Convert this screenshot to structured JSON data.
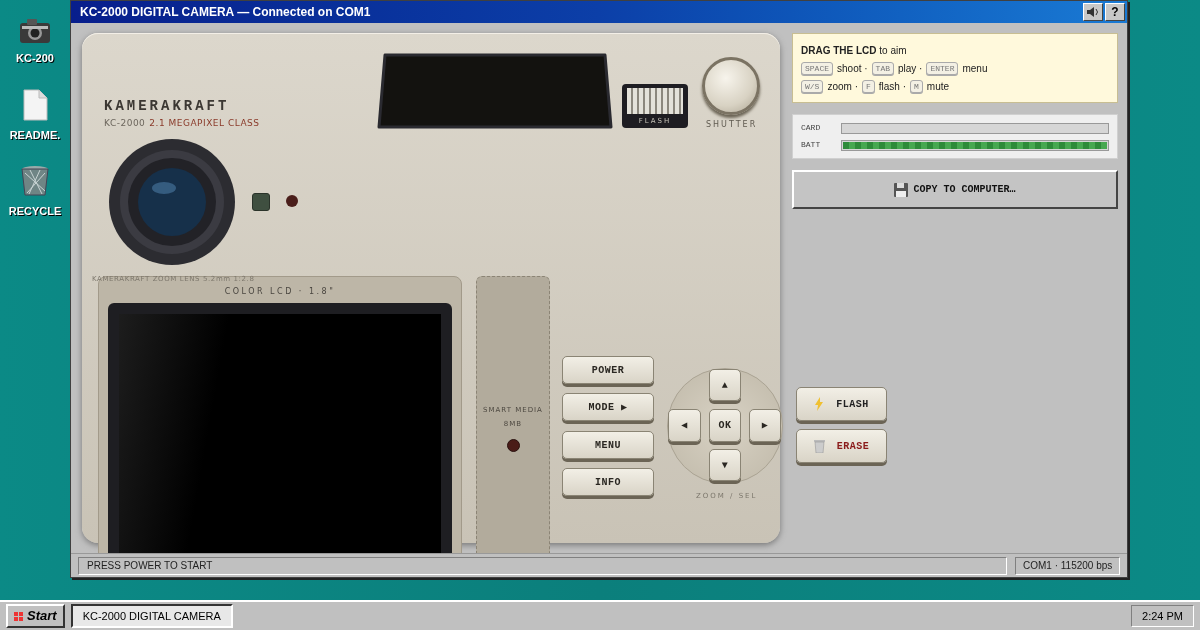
{
  "desktop_icons": [
    {
      "kind": "camera",
      "label": "KC-200"
    },
    {
      "kind": "document",
      "label": "README."
    },
    {
      "kind": "trash",
      "label": "RECYCLE"
    }
  ],
  "window": {
    "title": "KC-2000 DIGITAL CAMERA — Connected on COM1",
    "help_button": "?"
  },
  "camera": {
    "brand": "KAMERAKRAFT",
    "model": "KC-2000",
    "class": "2.1 MEGAPIXEL CLASS",
    "flash_label": "FLASH",
    "shutter_label": "SHUTTER",
    "lens_caption": "KAMERAKRAFT ZOOM LENS 5.2mm 1:2.8",
    "lcd_label": "COLOR LCD · 1.8\"",
    "media_label": "SMART MEDIA",
    "media_size": "8MB",
    "buttons": [
      "POWER",
      "MODE ▶",
      "MENU",
      "INFO"
    ],
    "dpad": {
      "up": "▲",
      "left": "◀",
      "ok": "OK",
      "right": "▶",
      "down": "▼",
      "label": "ZOOM / SEL"
    }
  },
  "hints": {
    "intro": "**DRAG THE LCD** to aim",
    "lines": [
      [
        {
          "key": "SPACE",
          "text": "shoot ·"
        },
        {
          "key": "TAB",
          "text": "play ·"
        },
        {
          "key": "ENTER",
          "text": "menu"
        }
      ],
      [
        {
          "key": "W/S",
          "text": "zoom ·"
        },
        {
          "key": "F",
          "text": "flash ·"
        },
        {
          "key": "M",
          "text": "mute"
        }
      ]
    ]
  },
  "meters": [
    {
      "label": "CARD",
      "level": 0
    },
    {
      "label": "BATT",
      "level": 1
    }
  ],
  "copy_button": "COPY TO COMPUTER…",
  "side_buttons": [
    {
      "kind": "flash",
      "label": "FLASH"
    },
    {
      "kind": "erase",
      "label": "ERASE"
    }
  ],
  "status_bar": {
    "message": "PRESS POWER TO START",
    "port": "COM1 · 115200 bps"
  },
  "taskbar": {
    "start": "Start",
    "tasks": [
      {
        "label": "KC-2000 DIGITAL CAMERA",
        "selected": true
      }
    ],
    "clock": "2:24 PM"
  }
}
